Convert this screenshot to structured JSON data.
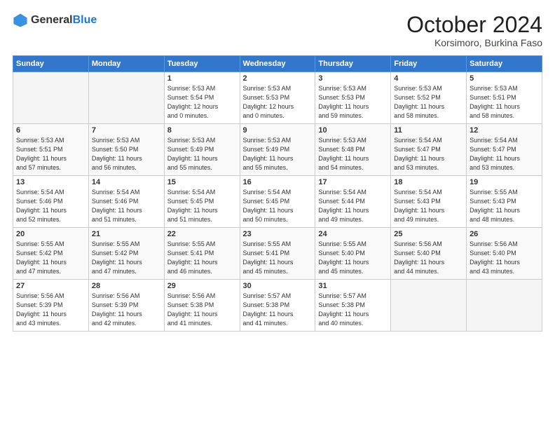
{
  "header": {
    "logo_general": "General",
    "logo_blue": "Blue",
    "month_title": "October 2024",
    "subtitle": "Korsimoro, Burkina Faso"
  },
  "days_of_week": [
    "Sunday",
    "Monday",
    "Tuesday",
    "Wednesday",
    "Thursday",
    "Friday",
    "Saturday"
  ],
  "weeks": [
    [
      {
        "day": "",
        "info": ""
      },
      {
        "day": "",
        "info": ""
      },
      {
        "day": "1",
        "info": "Sunrise: 5:53 AM\nSunset: 5:54 PM\nDaylight: 12 hours\nand 0 minutes."
      },
      {
        "day": "2",
        "info": "Sunrise: 5:53 AM\nSunset: 5:53 PM\nDaylight: 12 hours\nand 0 minutes."
      },
      {
        "day": "3",
        "info": "Sunrise: 5:53 AM\nSunset: 5:53 PM\nDaylight: 11 hours\nand 59 minutes."
      },
      {
        "day": "4",
        "info": "Sunrise: 5:53 AM\nSunset: 5:52 PM\nDaylight: 11 hours\nand 58 minutes."
      },
      {
        "day": "5",
        "info": "Sunrise: 5:53 AM\nSunset: 5:51 PM\nDaylight: 11 hours\nand 58 minutes."
      }
    ],
    [
      {
        "day": "6",
        "info": "Sunrise: 5:53 AM\nSunset: 5:51 PM\nDaylight: 11 hours\nand 57 minutes."
      },
      {
        "day": "7",
        "info": "Sunrise: 5:53 AM\nSunset: 5:50 PM\nDaylight: 11 hours\nand 56 minutes."
      },
      {
        "day": "8",
        "info": "Sunrise: 5:53 AM\nSunset: 5:49 PM\nDaylight: 11 hours\nand 55 minutes."
      },
      {
        "day": "9",
        "info": "Sunrise: 5:53 AM\nSunset: 5:49 PM\nDaylight: 11 hours\nand 55 minutes."
      },
      {
        "day": "10",
        "info": "Sunrise: 5:53 AM\nSunset: 5:48 PM\nDaylight: 11 hours\nand 54 minutes."
      },
      {
        "day": "11",
        "info": "Sunrise: 5:54 AM\nSunset: 5:47 PM\nDaylight: 11 hours\nand 53 minutes."
      },
      {
        "day": "12",
        "info": "Sunrise: 5:54 AM\nSunset: 5:47 PM\nDaylight: 11 hours\nand 53 minutes."
      }
    ],
    [
      {
        "day": "13",
        "info": "Sunrise: 5:54 AM\nSunset: 5:46 PM\nDaylight: 11 hours\nand 52 minutes."
      },
      {
        "day": "14",
        "info": "Sunrise: 5:54 AM\nSunset: 5:46 PM\nDaylight: 11 hours\nand 51 minutes."
      },
      {
        "day": "15",
        "info": "Sunrise: 5:54 AM\nSunset: 5:45 PM\nDaylight: 11 hours\nand 51 minutes."
      },
      {
        "day": "16",
        "info": "Sunrise: 5:54 AM\nSunset: 5:45 PM\nDaylight: 11 hours\nand 50 minutes."
      },
      {
        "day": "17",
        "info": "Sunrise: 5:54 AM\nSunset: 5:44 PM\nDaylight: 11 hours\nand 49 minutes."
      },
      {
        "day": "18",
        "info": "Sunrise: 5:54 AM\nSunset: 5:43 PM\nDaylight: 11 hours\nand 49 minutes."
      },
      {
        "day": "19",
        "info": "Sunrise: 5:55 AM\nSunset: 5:43 PM\nDaylight: 11 hours\nand 48 minutes."
      }
    ],
    [
      {
        "day": "20",
        "info": "Sunrise: 5:55 AM\nSunset: 5:42 PM\nDaylight: 11 hours\nand 47 minutes."
      },
      {
        "day": "21",
        "info": "Sunrise: 5:55 AM\nSunset: 5:42 PM\nDaylight: 11 hours\nand 47 minutes."
      },
      {
        "day": "22",
        "info": "Sunrise: 5:55 AM\nSunset: 5:41 PM\nDaylight: 11 hours\nand 46 minutes."
      },
      {
        "day": "23",
        "info": "Sunrise: 5:55 AM\nSunset: 5:41 PM\nDaylight: 11 hours\nand 45 minutes."
      },
      {
        "day": "24",
        "info": "Sunrise: 5:55 AM\nSunset: 5:40 PM\nDaylight: 11 hours\nand 45 minutes."
      },
      {
        "day": "25",
        "info": "Sunrise: 5:56 AM\nSunset: 5:40 PM\nDaylight: 11 hours\nand 44 minutes."
      },
      {
        "day": "26",
        "info": "Sunrise: 5:56 AM\nSunset: 5:40 PM\nDaylight: 11 hours\nand 43 minutes."
      }
    ],
    [
      {
        "day": "27",
        "info": "Sunrise: 5:56 AM\nSunset: 5:39 PM\nDaylight: 11 hours\nand 43 minutes."
      },
      {
        "day": "28",
        "info": "Sunrise: 5:56 AM\nSunset: 5:39 PM\nDaylight: 11 hours\nand 42 minutes."
      },
      {
        "day": "29",
        "info": "Sunrise: 5:56 AM\nSunset: 5:38 PM\nDaylight: 11 hours\nand 41 minutes."
      },
      {
        "day": "30",
        "info": "Sunrise: 5:57 AM\nSunset: 5:38 PM\nDaylight: 11 hours\nand 41 minutes."
      },
      {
        "day": "31",
        "info": "Sunrise: 5:57 AM\nSunset: 5:38 PM\nDaylight: 11 hours\nand 40 minutes."
      },
      {
        "day": "",
        "info": ""
      },
      {
        "day": "",
        "info": ""
      }
    ]
  ]
}
